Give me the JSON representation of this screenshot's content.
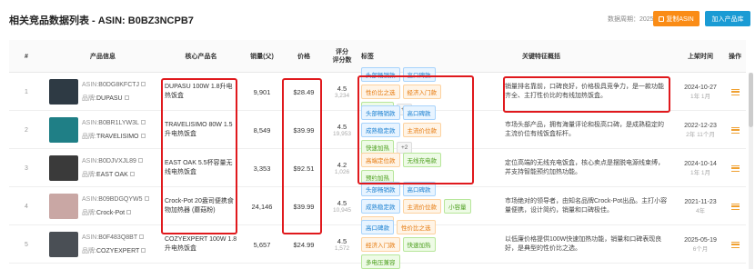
{
  "header": {
    "title": "相关竞品数据列表 - ASIN: B0BZ3NCPB7",
    "period_label": "数据周期：2025年10月",
    "copy_button": "复制ASIN",
    "add_button": "加入产品库"
  },
  "columns": {
    "index": "#",
    "product_info": "产品信息",
    "core_name": "核心产品名",
    "sales": "销量(父)",
    "price": "价格",
    "rating_line1": "评分",
    "rating_line2": "评分数",
    "tags": "标签",
    "summary": "关键特征概括",
    "launch": "上架时间",
    "action": "操作"
  },
  "labels": {
    "asin_prefix": "ASIN:",
    "brand_prefix": "品牌:"
  },
  "rows": [
    {
      "index": "1",
      "asin": "B0DG8KFCTJ",
      "brand": "DUPASU",
      "name": "DUPASU 100W 1.8升电热饭盒",
      "sales": "9,901",
      "price": "$28.49",
      "rating": "4.5",
      "reviews": "3,234",
      "tags": [
        {
          "text": "头部畅销款",
          "color": "blue"
        },
        {
          "text": "高口碑款",
          "color": "blue"
        },
        {
          "text": "性价比之选",
          "color": "orange"
        },
        {
          "text": "经济入门款",
          "color": "orange"
        },
        {
          "text": "快速加热",
          "color": "green"
        },
        {
          "text": "+2",
          "color": "gray"
        }
      ],
      "summary": "销量排名靠前，口碑良好，价格极具竞争力，是一款功能齐全、主打性价比的有线加热饭盒。",
      "launch_date": "2024-10-27",
      "launch_age": "1年 1月",
      "thumb_color": "#2e3a44"
    },
    {
      "index": "2",
      "asin": "B0BR1LYW3L",
      "brand": "TRAVELISIMO",
      "name": "TRAVELISIMO 80W 1.5升电热饭盒",
      "sales": "8,549",
      "price": "$39.99",
      "rating": "4.5",
      "reviews": "19,953",
      "tags": [
        {
          "text": "头部畅销款",
          "color": "blue"
        },
        {
          "text": "高口碑款",
          "color": "blue"
        },
        {
          "text": "成熟稳定款",
          "color": "blue"
        },
        {
          "text": "主流价位款",
          "color": "orange"
        },
        {
          "text": "快速加热",
          "color": "green"
        },
        {
          "text": "+2",
          "color": "gray"
        }
      ],
      "summary": "市场头部产品，拥有海量评论和极高口碑，是成熟稳定的主流价位有线饭盒标杆。",
      "launch_date": "2022-12-23",
      "launch_age": "2年 11个月",
      "thumb_color": "#1f7f86"
    },
    {
      "index": "3",
      "asin": "B0DJVXJL89",
      "brand": "EAST OAK",
      "name": "EAST OAK 5.5杯容量无线电热饭盒",
      "sales": "3,353",
      "price": "$92.51",
      "rating": "4.2",
      "reviews": "1,026",
      "tags": [
        {
          "text": "高端定位款",
          "color": "orange"
        },
        {
          "text": "无线充电款",
          "color": "green"
        },
        {
          "text": "预约加热",
          "color": "green"
        }
      ],
      "summary": "定位高端的无线充电饭盒，核心卖点是摆脱电源线束缚，并支持智能预约加热功能。",
      "launch_date": "2024-10-14",
      "launch_age": "1年 1月",
      "thumb_color": "#3a3a3a"
    },
    {
      "index": "4",
      "asin": "B09BDGQYW5",
      "brand": "Crock-Pot",
      "name": "Crock-Pot 20盎司便携食物加热器 (蘑菇粉)",
      "sales": "24,146",
      "price": "$39.99",
      "rating": "4.5",
      "reviews": "10,945",
      "tags": [
        {
          "text": "头部畅销款",
          "color": "blue"
        },
        {
          "text": "高口碑款",
          "color": "blue"
        },
        {
          "text": "成熟稳定款",
          "color": "blue"
        },
        {
          "text": "主流价位款",
          "color": "orange"
        },
        {
          "text": "小容量",
          "color": "green"
        },
        {
          "text": "知名品牌",
          "color": "orange"
        }
      ],
      "summary": "市场绝对的领导者，由知名品牌Crock-Pot出品。主打小容量便携，设计简约，销量和口碑极佳。",
      "launch_date": "2021-11-23",
      "launch_age": "4年",
      "thumb_color": "#c9a7a4"
    },
    {
      "index": "5",
      "asin": "B0F483Q8BT",
      "brand": "COZYEXPERT",
      "name": "COZYEXPERT 100W 1.8升电热饭盒",
      "sales": "5,657",
      "price": "$24.99",
      "rating": "4.5",
      "reviews": "1,572",
      "tags": [
        {
          "text": "高口碑款",
          "color": "blue"
        },
        {
          "text": "性价比之选",
          "color": "orange"
        },
        {
          "text": "经济入门款",
          "color": "orange"
        },
        {
          "text": "快速加热",
          "color": "green"
        },
        {
          "text": "多电压兼容",
          "color": "green"
        }
      ],
      "summary": "以低廉价格提供100W快速加热功能，销量和口碑表现良好，是典型的性价比之选。",
      "launch_date": "2025-05-19",
      "launch_age": "6个月",
      "thumb_color": "#4a4f55"
    }
  ]
}
